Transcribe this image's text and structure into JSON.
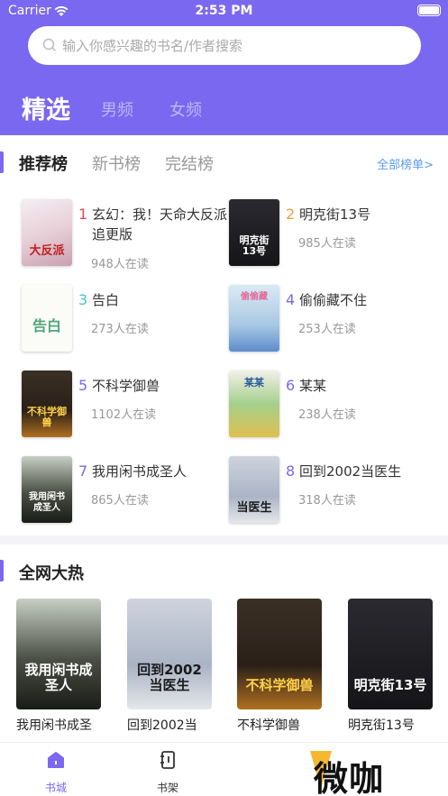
{
  "status": {
    "carrier": "Carrier",
    "time": "2:53 PM"
  },
  "search": {
    "placeholder": "输入你感兴趣的书名/作者搜索"
  },
  "channels": [
    "精选",
    "男频",
    "女频"
  ],
  "rank_tabs": {
    "items": [
      "推荐榜",
      "新书榜",
      "完结榜"
    ],
    "all_label": "全部榜单>"
  },
  "rank_list": [
    {
      "rank": "1",
      "title": "玄幻：我！天命大反派追更版",
      "readers": "948人在读",
      "cover_text": "大反派"
    },
    {
      "rank": "2",
      "title": "明克街13号",
      "readers": "985人在读",
      "cover_text": "明克街13号"
    },
    {
      "rank": "3",
      "title": "告白",
      "readers": "273人在读",
      "cover_text": "告白"
    },
    {
      "rank": "4",
      "title": "偷偷藏不住",
      "readers": "253人在读",
      "cover_text": "偷偷藏"
    },
    {
      "rank": "5",
      "title": "不科学御兽",
      "readers": "1102人在读",
      "cover_text": "不科学御兽"
    },
    {
      "rank": "6",
      "title": "某某",
      "readers": "238人在读",
      "cover_text": "某某"
    },
    {
      "rank": "7",
      "title": "我用闲书成圣人",
      "readers": "865人在读",
      "cover_text": "我用闲书成圣人"
    },
    {
      "rank": "8",
      "title": "回到2002当医生",
      "readers": "318人在读",
      "cover_text": "当医生"
    }
  ],
  "hot": {
    "title": "全网大热",
    "items": [
      {
        "label": "我用闲书成圣",
        "cover_text": "我用闲书成圣人"
      },
      {
        "label": "回到2002当",
        "cover_text": "回到2002当医生"
      },
      {
        "label": "不科学御兽",
        "cover_text": "不科学御兽"
      },
      {
        "label": "明克街13号",
        "cover_text": "明克街13号"
      }
    ]
  },
  "tabbar": {
    "items": [
      "书城",
      "书架"
    ]
  },
  "watermark": "微咖",
  "colors": {
    "accent": "#7b68f0",
    "rank_top": "#e84a4a",
    "rank_2": "#f0a030",
    "rank_3": "#40c8d0",
    "rank_rest": "#7b68f0",
    "link": "#5a9cf0"
  },
  "icons": {
    "search": "search-icon",
    "wifi": "wifi-icon",
    "battery": "battery-icon",
    "home": "home-icon",
    "shelf": "bookshelf-icon"
  }
}
